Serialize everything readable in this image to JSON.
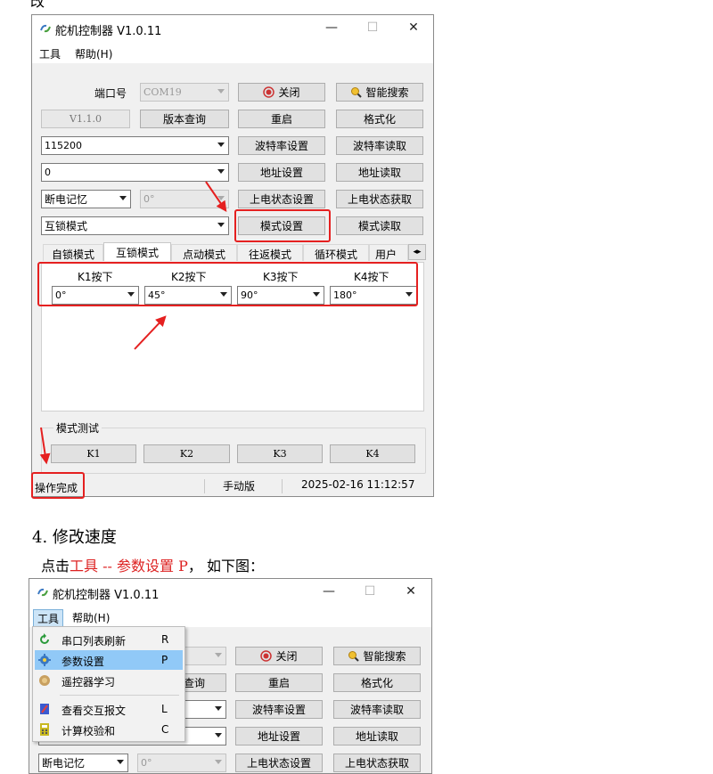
{
  "top_text": "改",
  "window1": {
    "title": "舵机控制器 V1.0.11",
    "menu": [
      "工具",
      "帮助(H)"
    ],
    "port_label": "端口号",
    "port_value": "COM19",
    "close_btn": "关闭",
    "smart_search_btn": "智能搜索",
    "version_value": "V1.1.0",
    "version_query_btn": "版本查询",
    "restart_btn": "重启",
    "format_btn": "格式化",
    "baud_value": "115200",
    "baud_set_btn": "波特率设置",
    "baud_read_btn": "波特率读取",
    "addr_value": "0",
    "addr_set_btn": "地址设置",
    "addr_read_btn": "地址读取",
    "power_memory": "断电记忆",
    "angle_value": "0°",
    "power_state_set_btn": "上电状态设置",
    "power_state_read_btn": "上电状态获取",
    "mode_value": "互锁模式",
    "mode_set_btn": "模式设置",
    "mode_read_btn": "模式读取",
    "tabs": [
      "自锁模式",
      "互锁模式",
      "点动模式",
      "往返模式",
      "循环模式",
      "用户"
    ],
    "keys": [
      {
        "label": "K1按下",
        "value": "0°"
      },
      {
        "label": "K2按下",
        "value": "45°"
      },
      {
        "label": "K3按下",
        "value": "90°"
      },
      {
        "label": "K4按下",
        "value": "180°"
      }
    ],
    "mode_test_label": "模式测试",
    "test_buttons": [
      "K1",
      "K2",
      "K3",
      "K4"
    ],
    "status_text": "操作完成",
    "status_mode": "手动版",
    "status_time": "2025-02-16 11:12:57"
  },
  "section_heading": "4. 修改速度",
  "instruction": {
    "prefix": "点击",
    "highlight": "工具 -- 参数设置 P",
    "suffix": "， 如下图："
  },
  "window2": {
    "title": "舵机控制器 V1.0.11",
    "menu": [
      "工具",
      "帮助(H)"
    ],
    "close_btn": "关闭",
    "smart_search_btn": "智能搜索",
    "query_partial": "查询",
    "restart_btn": "重启",
    "format_btn": "格式化",
    "baud_set_btn": "波特率设置",
    "baud_read_btn": "波特率读取",
    "addr_set_btn": "地址设置",
    "addr_read_btn": "地址读取",
    "power_memory": "断电记忆",
    "angle_value": "0°",
    "power_state_set_btn": "上电状态设置",
    "power_state_read_btn": "上电状态获取",
    "dropdown": [
      {
        "icon": "refresh-icon",
        "label": "串口列表刷新",
        "key": "R"
      },
      {
        "icon": "gear-icon",
        "label": "参数设置",
        "key": "P"
      },
      {
        "icon": "remote-learn-icon",
        "label": "遥控器学习",
        "key": ""
      },
      {
        "icon": "report-icon",
        "label": "查看交互报文",
        "key": "L"
      },
      {
        "icon": "calculator-icon",
        "label": "计算校验和",
        "key": "C"
      }
    ]
  },
  "colors": {
    "highlight_red": "#e52020",
    "menu_selected": "#91c9f7",
    "window_bg": "#f0f0f0",
    "button_bg": "#e1e1e1"
  }
}
